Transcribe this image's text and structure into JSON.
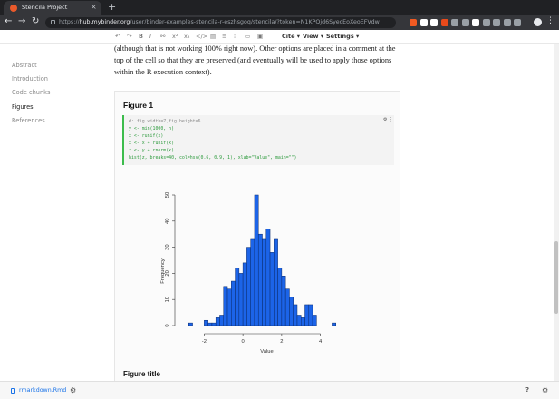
{
  "browser": {
    "tab_title": "Stencila Project",
    "tab_close": "×",
    "new_tab": "+",
    "back": "←",
    "forward": "→",
    "reload": "↻",
    "url_host": "hub.mybinder.org",
    "url_scheme": "https://",
    "url_path": "/user/binder-examples-stencila-r-eszhsgoq/stencila/?token=N1KPQjd6SyecEoXeoEFVdw",
    "menu": "⋮",
    "extension_colors": [
      "#f15a22",
      "#ffffff",
      "#ffffff",
      "#e84a1b",
      "#9aa0a6",
      "#9aa0a6",
      "#ffffff",
      "#9aa0a6",
      "#9aa0a6",
      "#9aa0a6",
      "#9aa0a6"
    ]
  },
  "editor_toolbar": {
    "icons": [
      "↶",
      "↷",
      "B",
      "I",
      "⚯",
      "x²",
      "x₂",
      "</>",
      "▤",
      "≡",
      "⁝",
      "▭",
      "▣"
    ],
    "cite_label": "Cite ▾",
    "view_label": "View ▾",
    "settings_label": "Settings ▾"
  },
  "sidebar": {
    "items": [
      {
        "label": "Abstract",
        "active": false
      },
      {
        "label": "Introduction",
        "active": false
      },
      {
        "label": "Code chunks",
        "active": false
      },
      {
        "label": "Figures",
        "active": true
      },
      {
        "label": "References",
        "active": false
      }
    ]
  },
  "content": {
    "intro_text": "(although that is not working 100% right now). Other options are placed in a comment at the top of the cell so that they are preserved (and eventually will be used to apply those options within the R execution context).",
    "figure_heading": "Figure 1",
    "run_icon": "⚙ ⋮",
    "code_lines": [
      "#: fig.width=7,fig.height=6",
      "y <- min(1000, n)",
      "x <- runif(x)",
      "x <- x + runif(x)",
      "z <- y + rnorm(x)",
      "hist(z, breaks=40, col=hsv(0.6, 0.9, 1), xlab=\"Value\", main=\"\")"
    ],
    "figure_title": "Figure title"
  },
  "chart_data": {
    "type": "bar",
    "title": "",
    "xlabel": "Value",
    "ylabel": "Frequency",
    "xlim": [
      -3,
      5
    ],
    "ylim": [
      0,
      50
    ],
    "x_ticks": [
      -2,
      0,
      2,
      4
    ],
    "y_ticks": [
      0,
      10,
      20,
      30,
      40,
      50
    ],
    "bin_width": 0.2,
    "bin_starts": [
      -2.8,
      -2.6,
      -2.4,
      -2.2,
      -2.0,
      -1.8,
      -1.6,
      -1.4,
      -1.2,
      -1.0,
      -0.8,
      -0.6,
      -0.4,
      -0.2,
      0.0,
      0.2,
      0.4,
      0.6,
      0.8,
      1.0,
      1.2,
      1.4,
      1.6,
      1.8,
      2.0,
      2.2,
      2.4,
      2.6,
      2.8,
      3.0,
      3.2,
      3.4,
      3.6,
      3.8,
      4.0,
      4.2,
      4.4,
      4.6
    ],
    "values": [
      1,
      0,
      0,
      0,
      2,
      1,
      1,
      3,
      4,
      15,
      14,
      17,
      22,
      20,
      24,
      30,
      33,
      50,
      35,
      33,
      37,
      28,
      33,
      22,
      19,
      14,
      11,
      8,
      4,
      3,
      8,
      8,
      4,
      0,
      0,
      0,
      0,
      1
    ],
    "bar_color": "#1c64e8",
    "grid": false
  },
  "statusbar": {
    "file_name": "rmarkdown.Rmd",
    "settings_icon": "⚙",
    "help_icon": "?",
    "gear_icon": "⚙"
  }
}
